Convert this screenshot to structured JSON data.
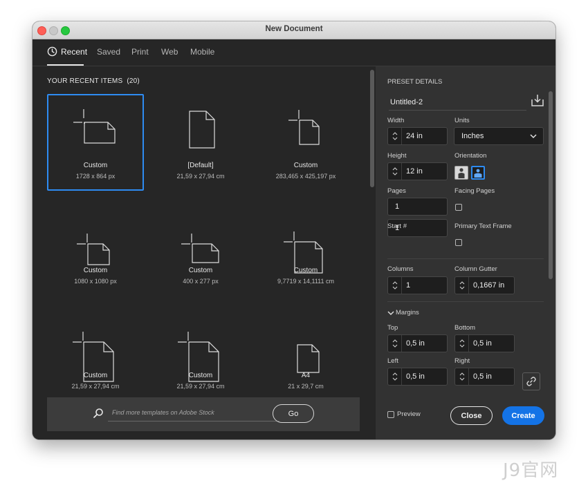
{
  "window": {
    "title": "New Document"
  },
  "tabs": [
    {
      "label": "Recent",
      "active": true
    },
    {
      "label": "Saved"
    },
    {
      "label": "Print"
    },
    {
      "label": "Web"
    },
    {
      "label": "Mobile"
    }
  ],
  "recent": {
    "heading": "YOUR RECENT ITEMS",
    "count": "(20)",
    "items": [
      {
        "name": "Custom",
        "size": "1728 x 864 px",
        "icon": "landscape-page-icon",
        "selected": true
      },
      {
        "name": "[Default]",
        "size": "21,59 x 27,94 cm",
        "icon": "portrait-page-icon"
      },
      {
        "name": "Custom",
        "size": "283,465 x 425,197 px",
        "icon": "portrait-page-icon"
      },
      {
        "name": "Custom",
        "size": "1080 x 1080 px",
        "icon": "square-page-icon"
      },
      {
        "name": "Custom",
        "size": "400 x 277 px",
        "icon": "landscape-page-icon"
      },
      {
        "name": "Custom",
        "size": "9,7719 x 14,1111 cm",
        "icon": "portrait-page-icon"
      },
      {
        "name": "Custom",
        "size": "21,59 x 27,94 cm",
        "icon": "portrait-page-icon"
      },
      {
        "name": "Custom",
        "size": "21,59 x 27,94 cm",
        "icon": "portrait-page-icon"
      },
      {
        "name": "A4",
        "size": "21 x 29,7 cm",
        "icon": "portrait-page-icon"
      }
    ]
  },
  "search": {
    "placeholder": "Find more templates on Adobe Stock",
    "go_label": "Go"
  },
  "preset": {
    "heading": "PRESET DETAILS",
    "doc_name": "Untitled-2",
    "width_label": "Width",
    "width_value": "24 in",
    "units_label": "Units",
    "units_value": "Inches",
    "height_label": "Height",
    "height_value": "12 in",
    "orientation_label": "Orientation",
    "orientation_value": "landscape",
    "pages_label": "Pages",
    "pages_value": "1",
    "facing_label": "Facing Pages",
    "facing_checked": false,
    "start_label": "Start #",
    "start_value": "1",
    "ptf_label": "Primary Text Frame",
    "ptf_checked": false,
    "columns_label": "Columns",
    "columns_value": "1",
    "gutter_label": "Column Gutter",
    "gutter_value": "0,1667 in",
    "margins_label": "Margins",
    "top_label": "Top",
    "top_value": "0,5 in",
    "bottom_label": "Bottom",
    "bottom_value": "0,5 in",
    "left_label": "Left",
    "left_value": "0,5 in",
    "right_label": "Right",
    "right_value": "0,5 in"
  },
  "actions": {
    "preview_label": "Preview",
    "preview_checked": false,
    "close_label": "Close",
    "create_label": "Create"
  },
  "colors": {
    "accent": "#1473e6",
    "selection": "#2e8cf3"
  },
  "watermark": "J9官网"
}
